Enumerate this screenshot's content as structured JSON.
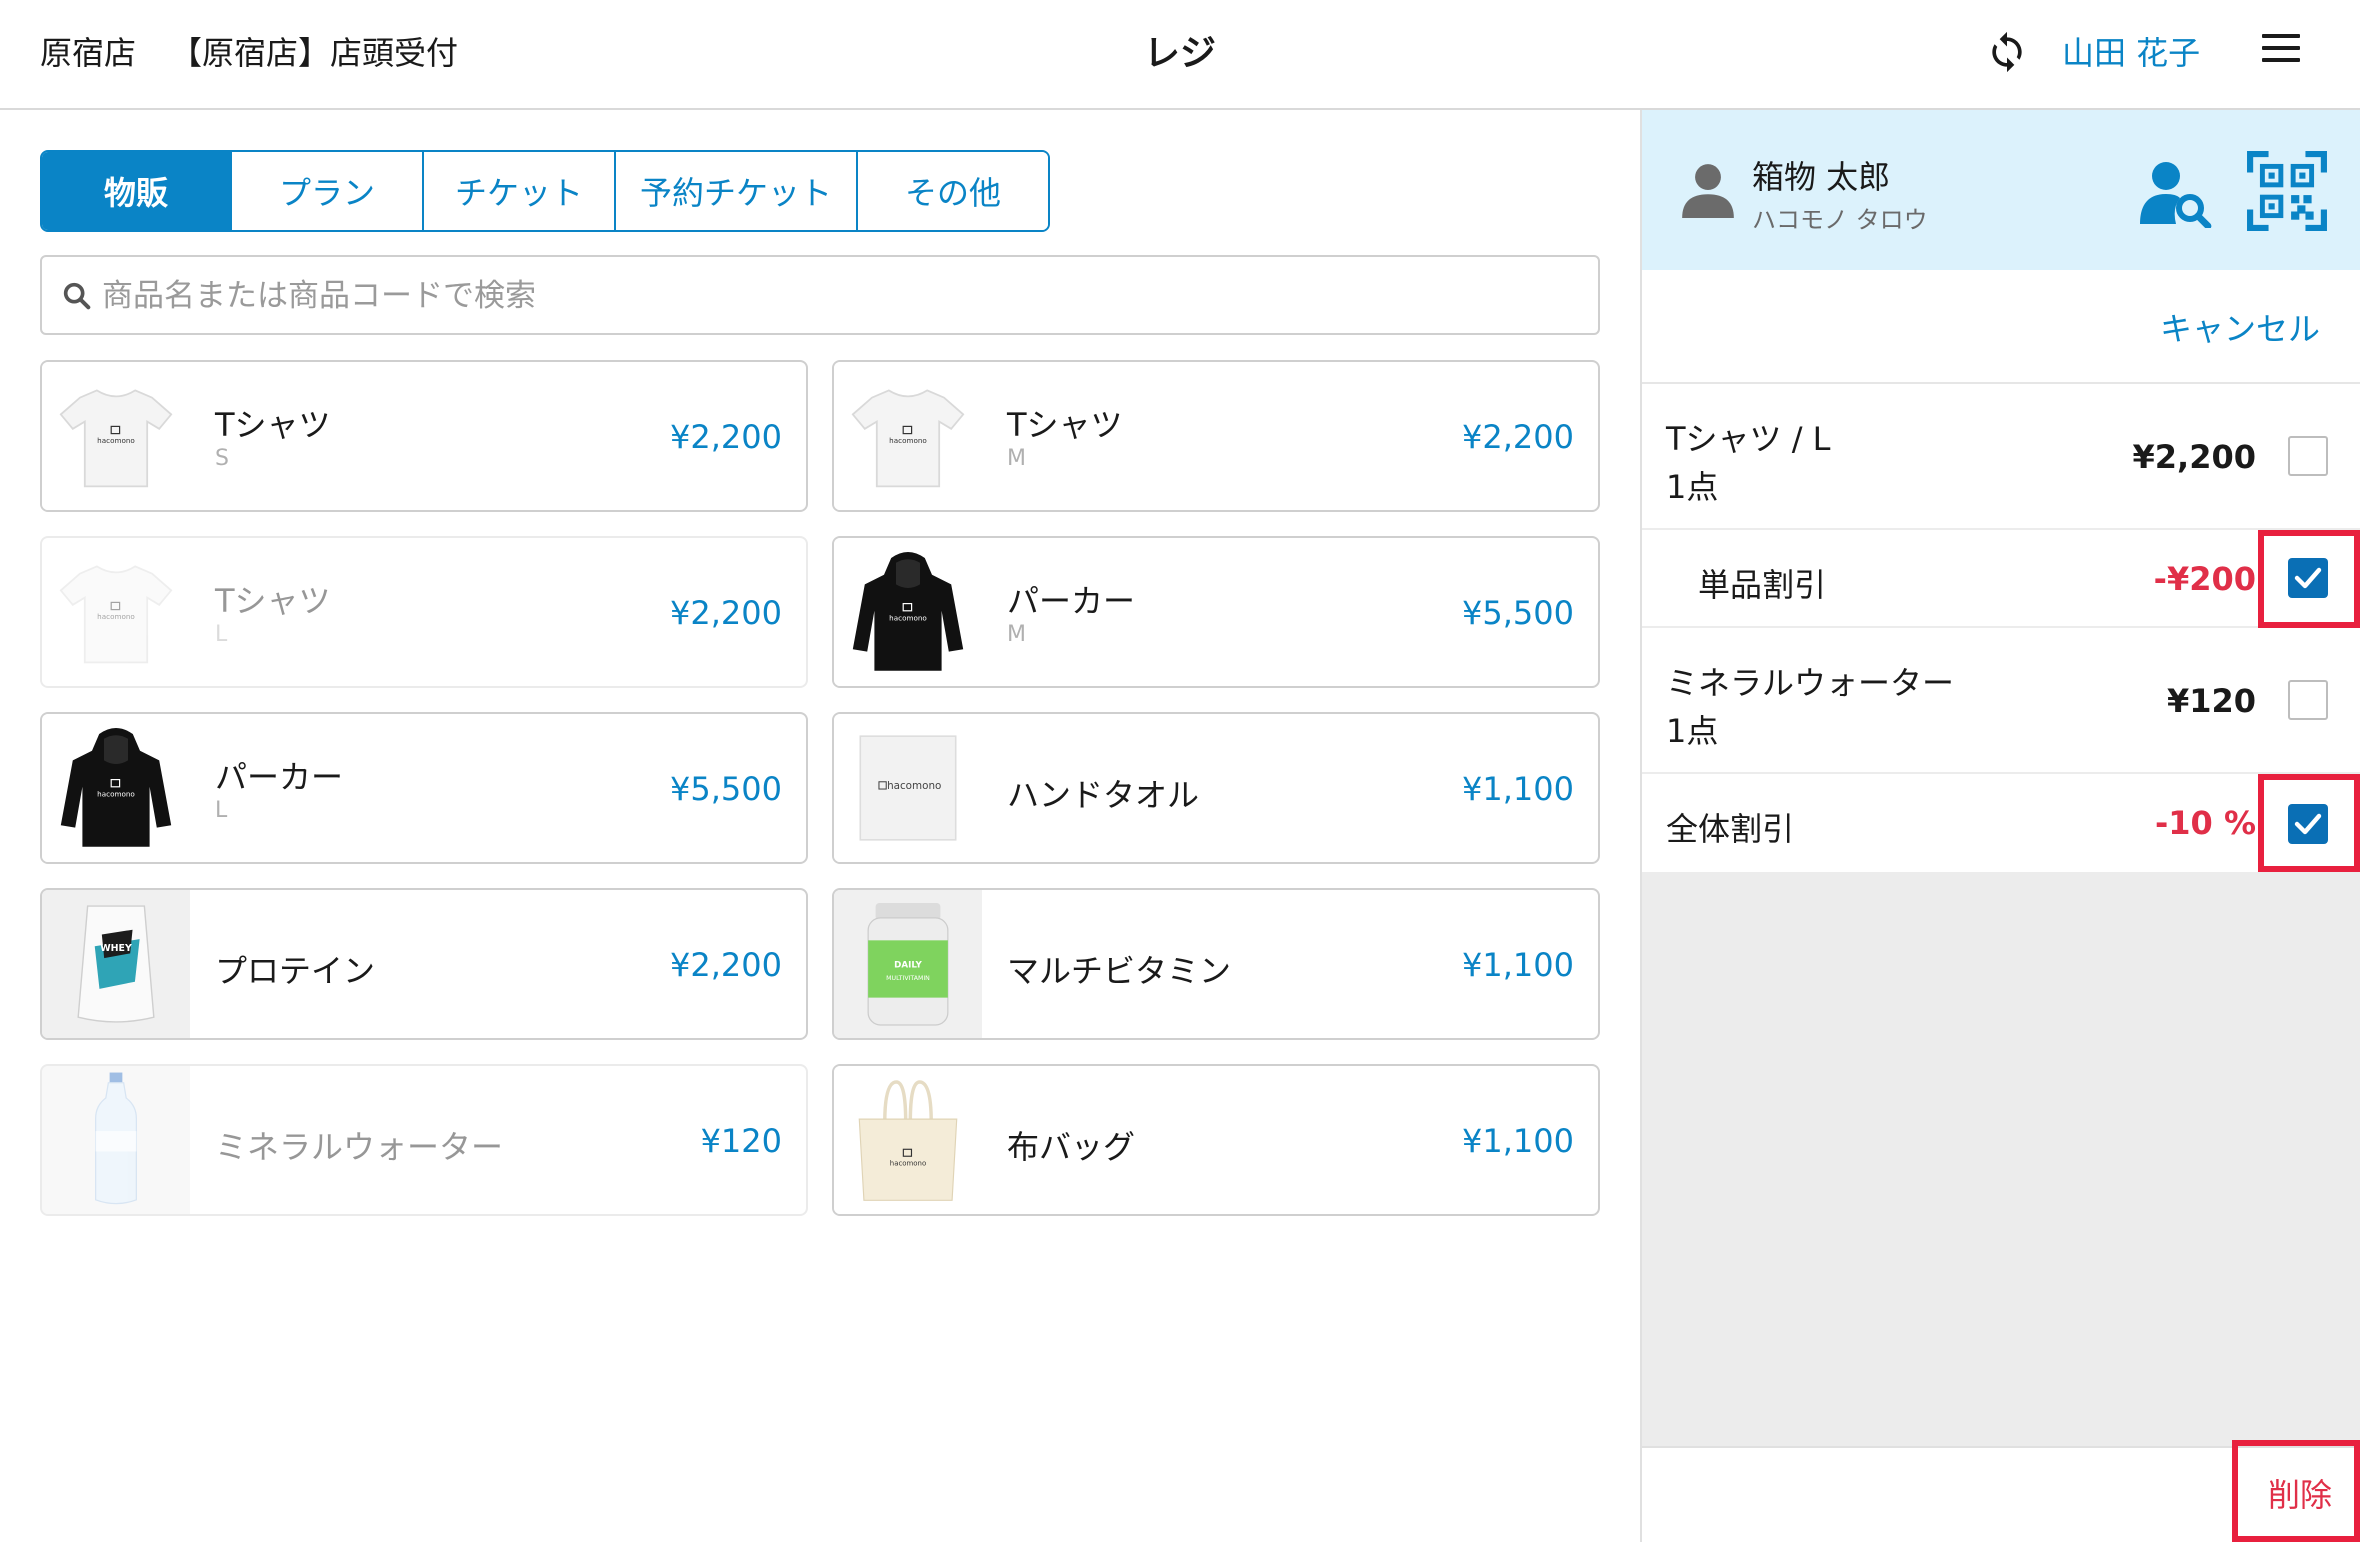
{
  "header": {
    "store": "原宿店",
    "reception": "【原宿店】店頭受付",
    "title": "レジ",
    "user": "山田 花子"
  },
  "tabs": [
    {
      "label": "物販",
      "active": true
    },
    {
      "label": "プラン",
      "active": false
    },
    {
      "label": "チケット",
      "active": false
    },
    {
      "label": "予約チケット",
      "active": false
    },
    {
      "label": "その他",
      "active": false
    }
  ],
  "search": {
    "placeholder": "商品名または商品コードで検索"
  },
  "products": [
    {
      "name": "Tシャツ",
      "variant": "S",
      "price": "¥2,200",
      "image": "tshirt-white",
      "disabled": false
    },
    {
      "name": "Tシャツ",
      "variant": "M",
      "price": "¥2,200",
      "image": "tshirt-white",
      "disabled": false
    },
    {
      "name": "Tシャツ",
      "variant": "L",
      "price": "¥2,200",
      "image": "tshirt-white",
      "disabled": true
    },
    {
      "name": "パーカー",
      "variant": "M",
      "price": "¥5,500",
      "image": "hoodie-black",
      "disabled": false
    },
    {
      "name": "パーカー",
      "variant": "L",
      "price": "¥5,500",
      "image": "hoodie-black",
      "disabled": false
    },
    {
      "name": "ハンドタオル",
      "variant": "",
      "price": "¥1,100",
      "image": "towel",
      "disabled": false
    },
    {
      "name": "プロテイン",
      "variant": "",
      "price": "¥2,200",
      "image": "protein-bag",
      "disabled": false
    },
    {
      "name": "マルチビタミン",
      "variant": "",
      "price": "¥1,100",
      "image": "vitamin-bottle",
      "disabled": false
    },
    {
      "name": "ミネラルウォーター",
      "variant": "",
      "price": "¥120",
      "image": "water-bottle",
      "disabled": true
    },
    {
      "name": "布バッグ",
      "variant": "",
      "price": "¥1,100",
      "image": "tote-bag",
      "disabled": false
    }
  ],
  "brand": "hacomono",
  "customer": {
    "name": "箱物 太郎",
    "kana": "ハコモノ タロウ"
  },
  "cart": {
    "cancel_label": "キャンセル",
    "lines": [
      {
        "name": "Tシャツ / L",
        "qty": "1点",
        "price": "¥2,200",
        "checked": false
      },
      {
        "name": "単品割引",
        "price": "-¥200",
        "checked": true
      },
      {
        "name": "ミネラルウォーター",
        "qty": "1点",
        "price": "¥120",
        "checked": false
      },
      {
        "name": "全体割引",
        "price": "-10 %",
        "checked": true
      }
    ],
    "delete_label": "削除"
  },
  "colors": {
    "accent": "#0a84c6",
    "discount": "#e02f48",
    "highlight": "#e8203e",
    "customer_bg": "#dcf2fc"
  }
}
